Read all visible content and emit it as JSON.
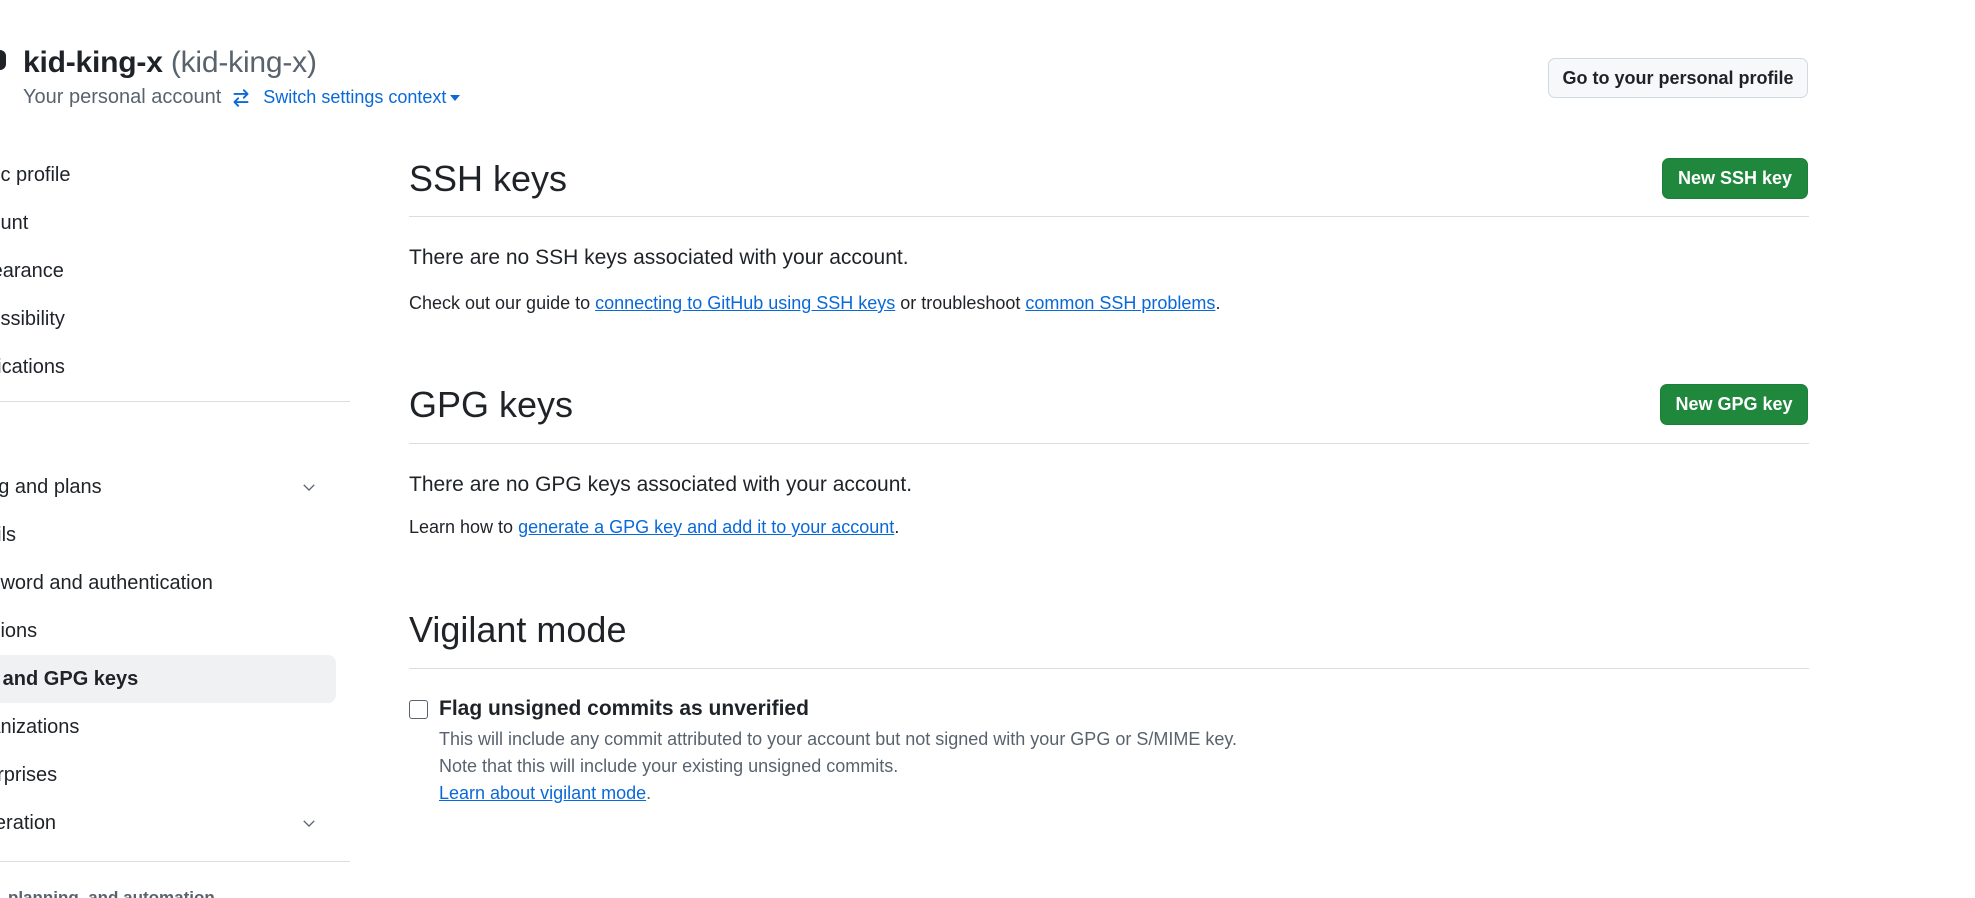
{
  "header": {
    "account_name": "kid-king-x",
    "account_login": "(kid-king-x)",
    "account_subtitle": "Your personal account",
    "switch_context_label": "Switch settings context",
    "profile_button_label": "Go to your personal profile"
  },
  "sidebar": {
    "items": [
      {
        "label": "Public profile"
      },
      {
        "label": "Account"
      },
      {
        "label": "Appearance"
      },
      {
        "label": "Accessibility"
      },
      {
        "label": "Notifications"
      },
      {
        "label": "Billing and plans"
      },
      {
        "label": "Emails"
      },
      {
        "label": "Password and authentication"
      },
      {
        "label": "Sessions"
      },
      {
        "label": "SSH and GPG keys",
        "active": true
      },
      {
        "label": "Organizations"
      },
      {
        "label": "Enterprises"
      },
      {
        "label": "Moderation"
      }
    ],
    "next_group_heading": "Code, planning, and automation"
  },
  "ssh": {
    "title": "SSH keys",
    "new_button_label": "New SSH key",
    "empty_message": "There are no SSH keys associated with your account.",
    "guide_prefix": "Check out our guide to ",
    "guide_link": "connecting to GitHub using SSH keys",
    "guide_middle": " or troubleshoot ",
    "problems_link": "common SSH problems",
    "guide_suffix": "."
  },
  "gpg": {
    "title": "GPG keys",
    "new_button_label": "New GPG key",
    "empty_message": "There are no GPG keys associated with your account.",
    "learn_prefix": "Learn how to ",
    "learn_link": "generate a GPG key and add it to your account",
    "learn_suffix": "."
  },
  "vigilant": {
    "title": "Vigilant mode",
    "checkbox_label": "Flag unsigned commits as unverified",
    "checked": false,
    "note_line1": "This will include any commit attributed to your account but not signed with your GPG or S/MIME key.",
    "note_line2": "Note that this will include your existing unsigned commits.",
    "learn_link": "Learn about vigilant mode",
    "learn_suffix": "."
  },
  "colors": {
    "primary_button": "#1f883d",
    "link": "#0969da",
    "muted_text": "#59636e",
    "active_nav_bg": "#eff1f3"
  }
}
